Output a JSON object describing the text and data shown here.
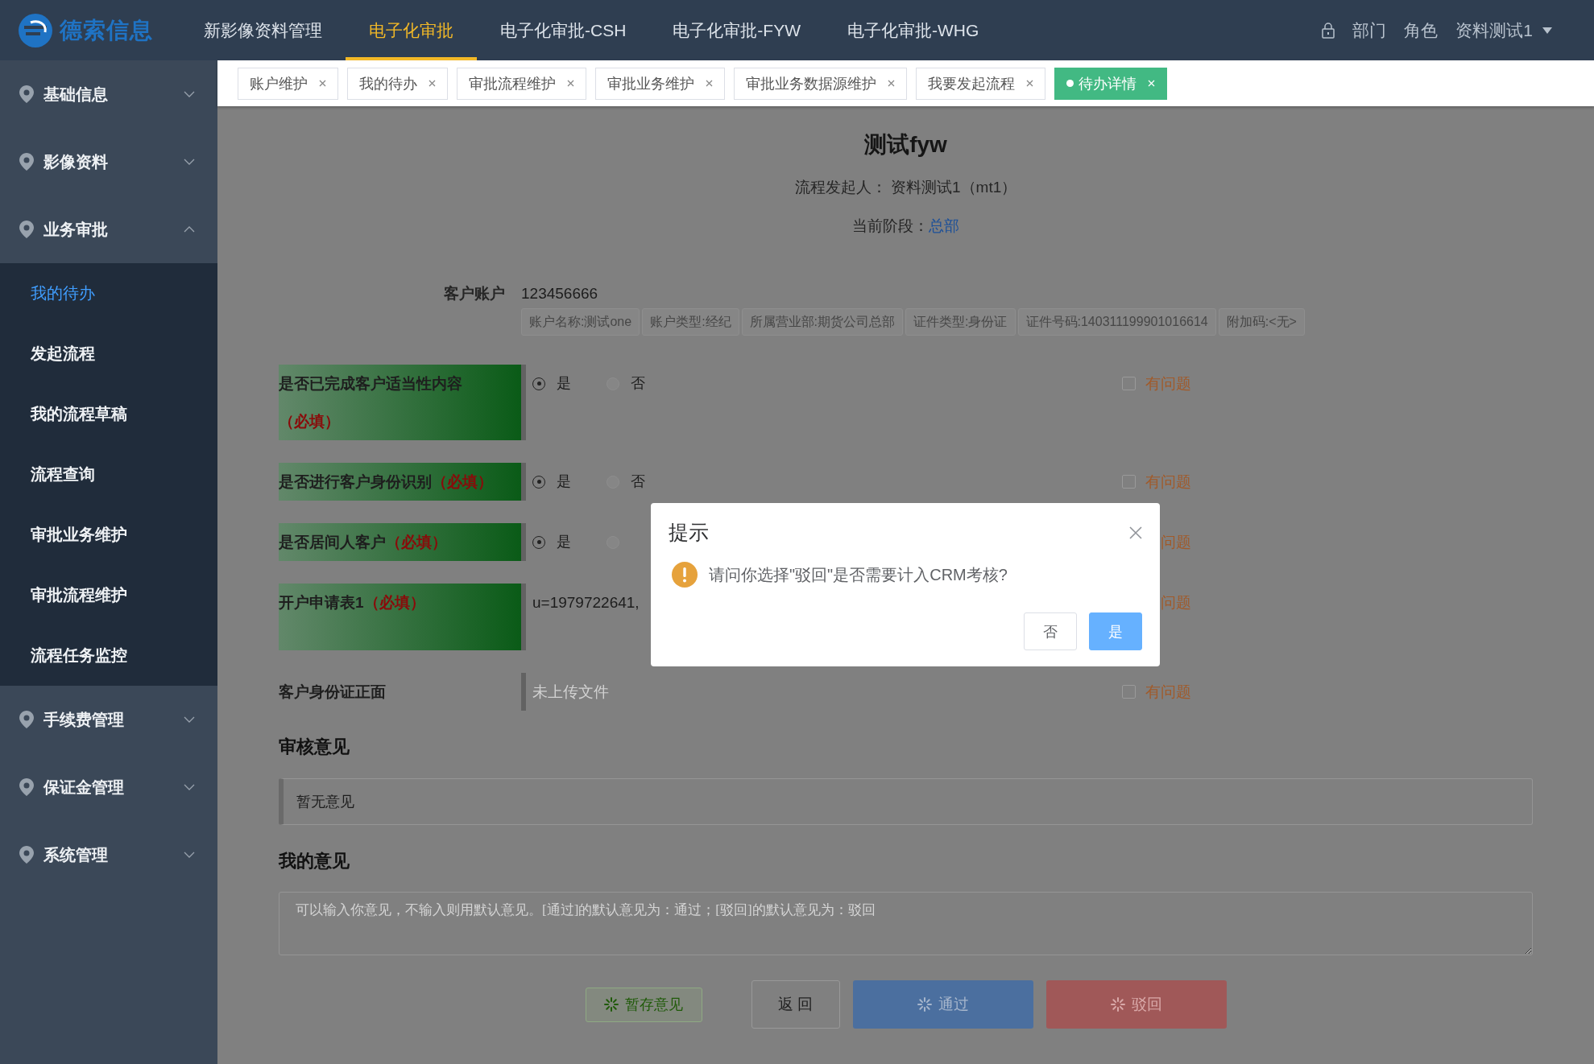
{
  "header": {
    "logo_text": "德索信息",
    "nav": [
      {
        "label": "新影像资料管理",
        "selected": false
      },
      {
        "label": "电子化审批",
        "selected": true
      },
      {
        "label": "电子化审批-CSH",
        "selected": false
      },
      {
        "label": "电子化审批-FYW",
        "selected": false
      },
      {
        "label": "电子化审批-WHG",
        "selected": false
      }
    ],
    "links": [
      "部门",
      "角色"
    ],
    "user": "资料测试1"
  },
  "sidebar": {
    "groups": [
      {
        "label": "基础信息",
        "expanded": false
      },
      {
        "label": "影像资料",
        "expanded": false
      },
      {
        "label": "业务审批",
        "expanded": true,
        "children": [
          {
            "label": "我的待办",
            "selected": true
          },
          {
            "label": "发起流程",
            "selected": false
          },
          {
            "label": "我的流程草稿",
            "selected": false
          },
          {
            "label": "流程查询",
            "selected": false
          },
          {
            "label": "审批业务维护",
            "selected": false
          },
          {
            "label": "审批流程维护",
            "selected": false
          },
          {
            "label": "流程任务监控",
            "selected": false
          }
        ]
      },
      {
        "label": "手续费管理",
        "expanded": false
      },
      {
        "label": "保证金管理",
        "expanded": false
      },
      {
        "label": "系统管理",
        "expanded": false
      }
    ]
  },
  "tabs": [
    {
      "label": "账户维护",
      "selected": false
    },
    {
      "label": "我的待办",
      "selected": false
    },
    {
      "label": "审批流程维护",
      "selected": false
    },
    {
      "label": "审批业务维护",
      "selected": false
    },
    {
      "label": "审批业务数据源维护",
      "selected": false
    },
    {
      "label": "我要发起流程",
      "selected": false
    },
    {
      "label": "待办详情",
      "selected": true
    }
  ],
  "page": {
    "title": "测试fyw",
    "initiator": "流程发起人：  资料测试1（mt1）",
    "stage_label": "当前阶段：",
    "stage": "总部",
    "account": {
      "label": "客户账户",
      "value": "123456666",
      "tags": [
        "账户名称:测试one",
        "账户类型:经纪",
        "所属营业部:期货公司总部",
        "证件类型:身份证",
        "证件号码:140311199901016614",
        "附加码:<无>"
      ]
    },
    "fields": [
      {
        "kind": "radio",
        "label": "是否已完成客户适当性内容",
        "required": "（必填）",
        "options": [
          {
            "label": "是",
            "selected": true
          },
          {
            "label": "否",
            "selected": false
          }
        ],
        "issue": {
          "label": "有问题",
          "checked": false
        }
      },
      {
        "kind": "radio",
        "label": "是否进行客户身份识别",
        "required": "（必填）",
        "options": [
          {
            "label": "是",
            "selected": true
          },
          {
            "label": "否",
            "selected": false
          }
        ],
        "issue": {
          "label": "有问题",
          "checked": false
        }
      },
      {
        "kind": "radio",
        "label": "是否居间人客户",
        "required": "（必填）",
        "options": [
          {
            "label": "是",
            "selected": true
          },
          {
            "selected": false
          }
        ],
        "issue": {
          "label": "问题"
        }
      },
      {
        "kind": "text",
        "label": "开户申请表1",
        "required": "（必填）",
        "value": "u=1979722641,",
        "issue": {
          "label": "问题"
        }
      },
      {
        "kind": "file",
        "label": "客户身份证正面",
        "placeholder": "未上传文件",
        "issue": {
          "label": "有问题",
          "checked": false
        }
      }
    ],
    "review": {
      "heading": "审核意见",
      "value": "暂无意见"
    },
    "mine": {
      "heading": "我的意见",
      "placeholder": "可以输入你意见，不输入则用默认意见。[通过]的默认意见为：通过；[驳回]的默认意见为：驳回"
    },
    "buttons": [
      {
        "kind": "save",
        "label": "暂存意见"
      },
      {
        "kind": "back",
        "label": "返 回"
      },
      {
        "kind": "approve",
        "label": "通过"
      },
      {
        "kind": "reject",
        "label": "驳回"
      }
    ]
  },
  "dialog": {
    "title": "提示",
    "message": "请问你选择\"驳回\"是否需要计入CRM考核?",
    "buttons": [
      {
        "label": "否",
        "primary": false
      },
      {
        "label": "是",
        "primary": true
      }
    ]
  }
}
